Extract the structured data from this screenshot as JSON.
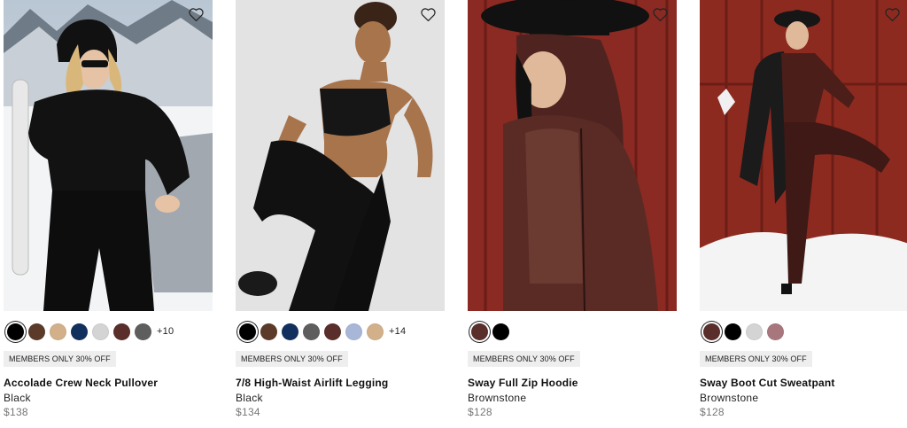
{
  "products": [
    {
      "name": "Accolade Crew Neck Pullover",
      "color": "Black",
      "price": "$138",
      "badge": "MEMBERS ONLY 30% OFF",
      "more_colors": "+10",
      "swatches": [
        "#000000",
        "#5b3a29",
        "#d2b08a",
        "#12305e",
        "#d4d4d4",
        "#5a2e2a",
        "#5e5e5e"
      ],
      "selected_swatch": 0
    },
    {
      "name": "7/8 High-Waist Airlift Legging",
      "color": "Black",
      "price": "$134",
      "badge": "MEMBERS ONLY 30% OFF",
      "more_colors": "+14",
      "swatches": [
        "#000000",
        "#5b3a29",
        "#12305e",
        "#5e5e5e",
        "#5a2e2a",
        "#a8b6d8",
        "#d2b08a"
      ],
      "selected_swatch": 0
    },
    {
      "name": "Sway Full Zip Hoodie",
      "color": "Brownstone",
      "price": "$128",
      "badge": "MEMBERS ONLY 30% OFF",
      "more_colors": "",
      "swatches": [
        "#5a2e2a",
        "#000000"
      ],
      "selected_swatch": 0
    },
    {
      "name": "Sway Boot Cut Sweatpant",
      "color": "Brownstone",
      "price": "$128",
      "badge": "MEMBERS ONLY 30% OFF",
      "more_colors": "",
      "swatches": [
        "#5a2e2a",
        "#000000",
        "#d4d4d4",
        "#a8777e"
      ],
      "selected_swatch": 0
    }
  ],
  "icons": {
    "favorite": "heart-outline-icon"
  }
}
